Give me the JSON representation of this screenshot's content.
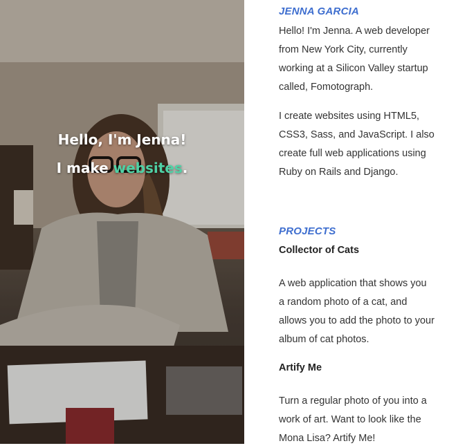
{
  "hero": {
    "greeting": "Hello, I'm Jenna!",
    "make_prefix": "I make ",
    "make_highlight": "websites",
    "make_suffix": ".",
    "accent_color": "#4fd1a5"
  },
  "about": {
    "title": "JENNA GARCIA",
    "paragraphs": [
      "Hello! I'm Jenna. A web developer from New York City, currently working at a Silicon Valley startup called, Fomotograph.",
      "I create websites using HTML5, CSS3, Sass, and JavaScript. I also create full web applications using Ruby on Rails and Django."
    ]
  },
  "projects": {
    "title": "PROJECTS",
    "items": [
      {
        "name": "Collector of Cats",
        "description": "A web application that shows you a random photo of a cat, and allows you to add the photo to your album of cat photos."
      },
      {
        "name": "Artify Me",
        "description": "Turn a regular photo of you into a work of art. Want to look like the Mona Lisa? Artify Me!"
      }
    ]
  },
  "colors": {
    "section_title": "#3e6ecf",
    "body_text": "#333333"
  }
}
